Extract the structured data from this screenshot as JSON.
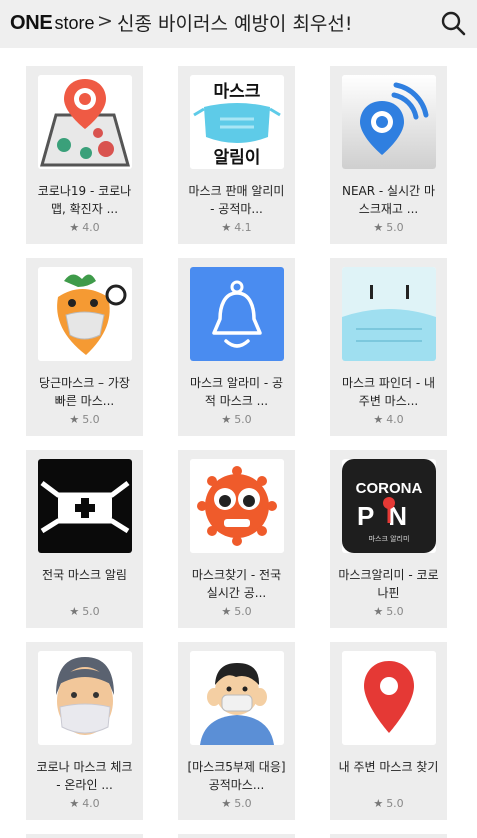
{
  "header": {
    "logo_one": "ONE",
    "logo_store": "store",
    "separator": ">",
    "title": "신종 바이러스 예방이 최우선!"
  },
  "apps": [
    {
      "name": "코로나19 - 코로나맵, 확진자 ...",
      "rating": "4.0",
      "icon": "corona-map-icon"
    },
    {
      "name": "마스크 판매 알리미 - 공적마...",
      "rating": "4.1",
      "icon": "mask-alert-icon"
    },
    {
      "name": "NEAR - 실시간 마스크재고 ...",
      "rating": "5.0",
      "icon": "near-location-icon"
    },
    {
      "name": "당근마스크 – 가장 빠른 마스...",
      "rating": "5.0",
      "icon": "carrot-mask-icon"
    },
    {
      "name": "마스크 알라미 - 공적 마스크 ...",
      "rating": "5.0",
      "icon": "bell-icon"
    },
    {
      "name": "마스크 파인더 - 내주변 마스...",
      "rating": "4.0",
      "icon": "mask-face-icon"
    },
    {
      "name": "전국 마스크 알림",
      "rating": "5.0",
      "icon": "mask-cross-icon"
    },
    {
      "name": "마스크찾기 - 전국 실시간 공...",
      "rating": "5.0",
      "icon": "virus-eyes-icon"
    },
    {
      "name": "마스크알리미 - 코로나핀",
      "rating": "5.0",
      "icon": "corona-pin-icon"
    },
    {
      "name": "코로나 마스크 체크 - 온라인 ...",
      "rating": "4.0",
      "icon": "masked-person-icon"
    },
    {
      "name": "[마스크5부제 대응] 공적마스...",
      "rating": "5.0",
      "icon": "boy-mask-icon"
    },
    {
      "name": "내 주변 마스크 찾기",
      "rating": "5.0",
      "icon": "red-pin-icon"
    }
  ],
  "icon_text": {
    "mask_alert_top": "마스크",
    "mask_alert_bottom": "알림이",
    "corona_word": "CORONA",
    "pin_word": "PN",
    "pin_sub": "마스크 알리미"
  },
  "colors": {
    "header_bg": "#efefef",
    "card_bg": "#ededed",
    "near_blue": "#2f7fe0",
    "bell_blue": "#4a8cf0",
    "pin_red": "#e53935"
  }
}
